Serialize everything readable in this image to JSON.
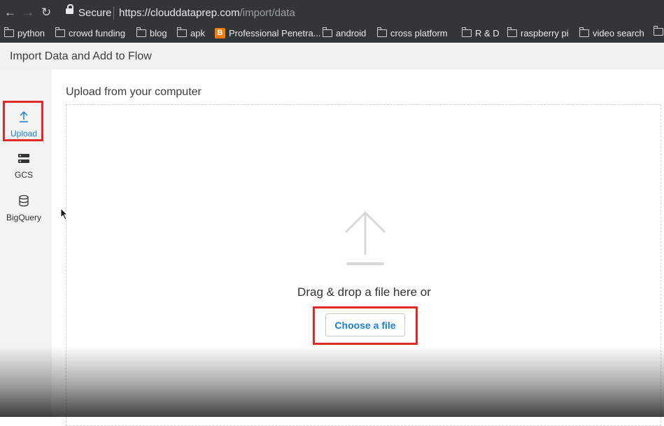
{
  "browser": {
    "security_label": "Secure",
    "url_prefix": "https://clouddataprep.com",
    "url_path": "/import/data",
    "bookmarks": [
      {
        "label": "python",
        "icon": "folder-icon"
      },
      {
        "label": "crowd funding",
        "icon": "folder-icon"
      },
      {
        "label": "blog",
        "icon": "folder-icon"
      },
      {
        "label": "apk",
        "icon": "folder-icon"
      },
      {
        "label": "Professional Penetra...",
        "icon": "blogger-icon"
      },
      {
        "label": "android",
        "icon": "folder-icon"
      },
      {
        "label": "cross platform",
        "icon": "folder-icon"
      },
      {
        "label": "R & D",
        "icon": "folder-icon"
      },
      {
        "label": "raspberry pi",
        "icon": "folder-icon"
      },
      {
        "label": "video search",
        "icon": "folder-icon"
      }
    ]
  },
  "header": {
    "title": "Import Data and Add to Flow"
  },
  "sidebar": {
    "items": [
      {
        "label": "Upload",
        "icon": "upload-arrow-icon",
        "active": true
      },
      {
        "label": "GCS",
        "icon": "server-icon",
        "active": false
      },
      {
        "label": "BigQuery",
        "icon": "database-icon",
        "active": false
      }
    ]
  },
  "upload": {
    "title": "Upload from your computer",
    "drag_text": "Drag & drop a file here or",
    "choose_label": "Choose a file"
  },
  "colors": {
    "accent": "#1a7fd0",
    "highlight": "#e02a2a",
    "browser_chrome": "#323639"
  }
}
